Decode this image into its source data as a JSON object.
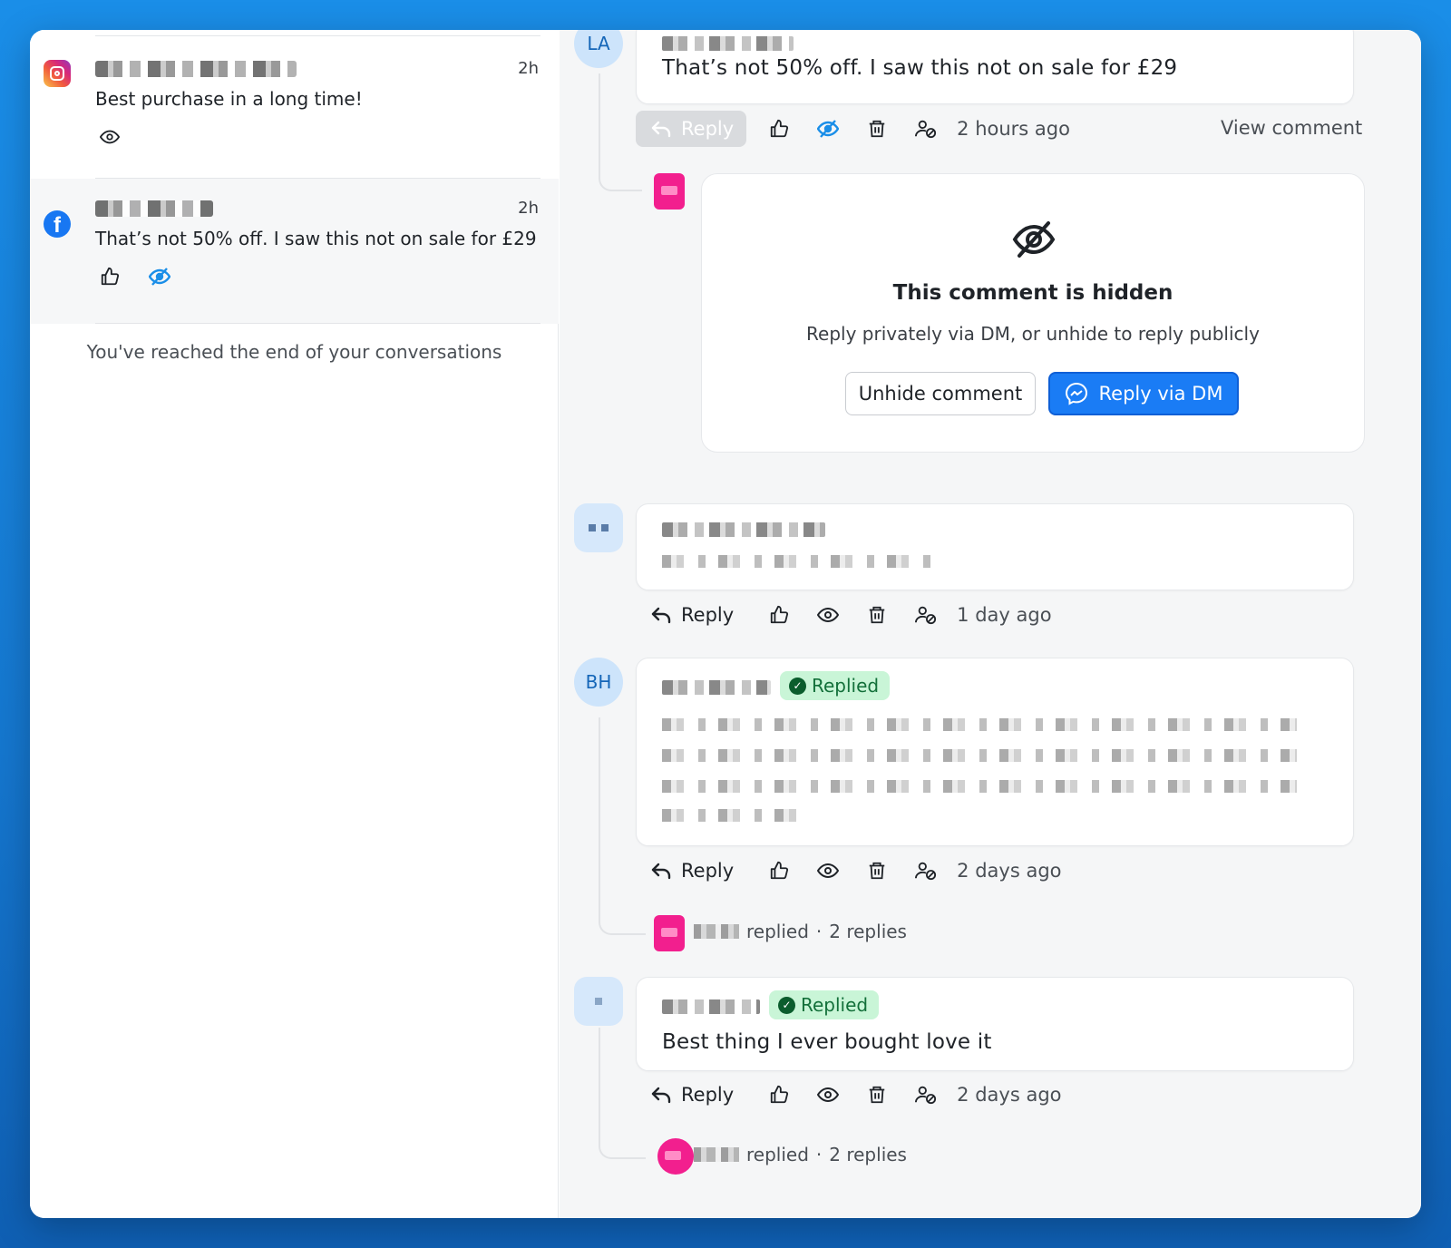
{
  "conversations": [
    {
      "network": "instagram",
      "time": "2h",
      "text": "Best purchase in a long time!",
      "icons": [
        "eye-icon"
      ]
    },
    {
      "network": "facebook",
      "time": "2h",
      "text": "That’s not 50% off. I saw this not on sale for £29",
      "icons": [
        "thumbs-up-icon",
        "eye-off-icon"
      ]
    }
  ],
  "end_message": "You've reached the end of your conversations",
  "thread": {
    "comment1": {
      "avatar": "LA",
      "text": "That’s not 50% off. I saw this not on sale for £29",
      "reply_label": "Reply",
      "time": "2 hours ago",
      "view_link": "View comment"
    },
    "hidden": {
      "title": "This comment is hidden",
      "subtitle": "Reply privately via DM, or unhide to reply publicly",
      "unhide_label": "Unhide comment",
      "dm_label": "Reply via DM"
    },
    "comment2": {
      "reply_label": "Reply",
      "time": "1 day ago"
    },
    "comment3": {
      "avatar": "BH",
      "badge": "Replied",
      "reply_label": "Reply",
      "time": "2 days ago",
      "replied_text": "replied",
      "replies_count": "2 replies"
    },
    "comment4": {
      "badge": "Replied",
      "text": "Best thing I ever bought love it",
      "reply_label": "Reply",
      "time": "2 days ago",
      "replied_text": "replied",
      "replies_count": "2 replies"
    }
  },
  "colors": {
    "accent": "#1a7cf5",
    "replied_badge_bg": "#c9f5d7",
    "replied_badge_text": "#13703a",
    "hidden_icon": "#1a8ee8"
  }
}
